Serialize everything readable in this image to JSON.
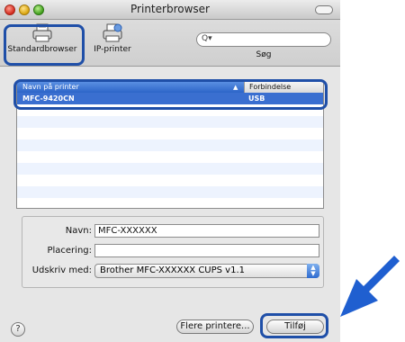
{
  "window": {
    "title": "Printerbrowser"
  },
  "toolbar": {
    "items": [
      {
        "label": "Standardbrowser",
        "icon": "printer-icon"
      },
      {
        "label": "IP-printer",
        "icon": "network-printer-icon"
      },
      {
        "label": "Søg",
        "icon": "search-icon"
      }
    ]
  },
  "list": {
    "columns": [
      "Navn på printer",
      "Forbindelse"
    ],
    "rows": [
      {
        "name": "MFC-9420CN",
        "connection": "USB",
        "selected": true
      }
    ]
  },
  "form": {
    "name_label": "Navn:",
    "name_value": "MFC-XXXXXX",
    "location_label": "Placering:",
    "location_value": "",
    "print_with_label": "Udskriv med:",
    "print_with_value": "Brother MFC-XXXXXX CUPS v1.1"
  },
  "buttons": {
    "help": "?",
    "more_printers": "Flere printere...",
    "add": "Tilføj"
  },
  "colors": {
    "highlight": "#1f4fa8",
    "selection": "#3a6fd0",
    "arrow": "#1f5fd0"
  }
}
